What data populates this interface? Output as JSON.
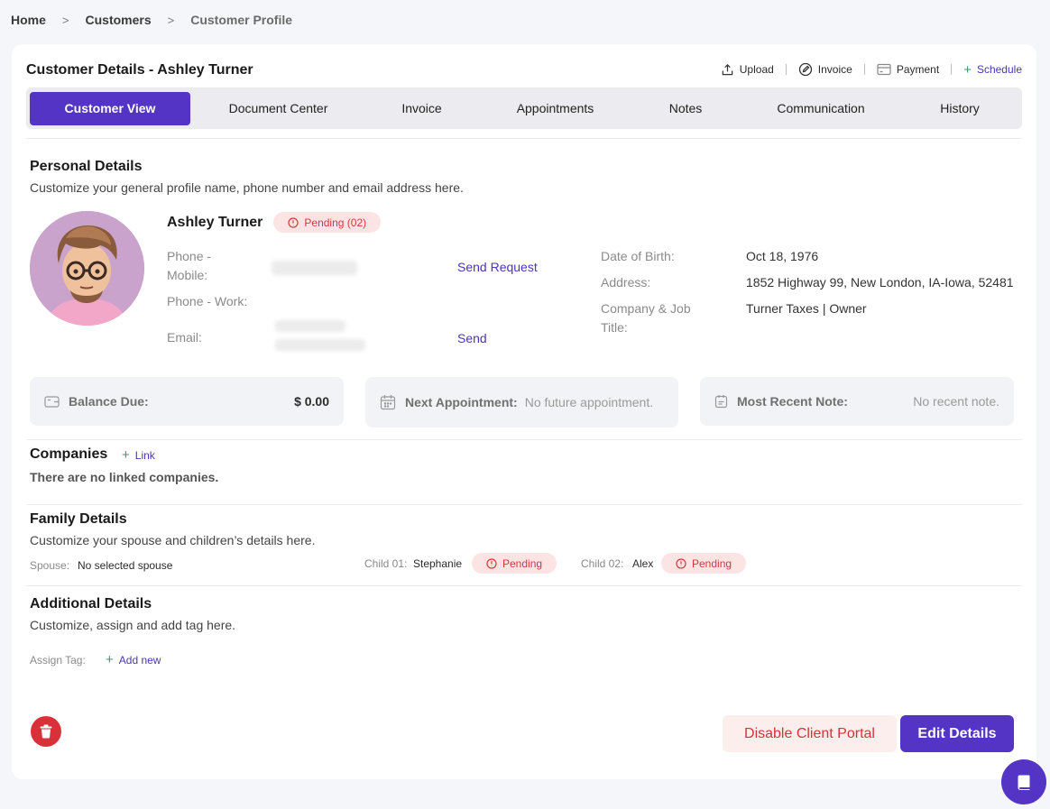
{
  "breadcrumb": {
    "home": "Home",
    "customers": "Customers",
    "current": "Customer Profile",
    "separator": ">"
  },
  "header": {
    "title": "Customer Details - Ashley Turner",
    "actions": {
      "upload": "Upload",
      "invoice": "Invoice",
      "payment": "Payment",
      "schedule": "Schedule"
    }
  },
  "tabs": [
    "Customer View",
    "Document Center",
    "Invoice",
    "Appointments",
    "Notes",
    "Communication",
    "History"
  ],
  "active_tab": "Customer View",
  "personal": {
    "title": "Personal Details",
    "subtitle": "Customize your general profile name, phone number and email address here.",
    "name": "Ashley Turner",
    "pending_badge": "Pending (02)",
    "phone_mobile_label_1": "Phone -",
    "phone_mobile_label_2": "Mobile:",
    "phone_work_label": "Phone - Work:",
    "email_label": "Email:",
    "send_request": "Send Request",
    "send": "Send",
    "dob_label": "Date of Birth:",
    "dob_value": "Oct 18, 1976",
    "address_label": "Address:",
    "address_value": "1852 Highway 99, New London, IA-Iowa, 52481",
    "company_label_1": "Company & Job",
    "company_label_2": "Title:",
    "company_value": "Turner Taxes | Owner"
  },
  "stats": {
    "balance_label": "Balance Due:",
    "balance_value": "$ 0.00",
    "appointment_label": "Next Appointment:",
    "appointment_value": "No future appointment.",
    "note_label": "Most Recent Note:",
    "note_value": "No recent note."
  },
  "companies": {
    "title": "Companies",
    "link": "Link",
    "empty": "There are no linked companies."
  },
  "family": {
    "title": "Family Details",
    "subtitle": "Customize your spouse and children’s details here.",
    "spouse_label": "Spouse:",
    "spouse_value": "No selected spouse",
    "child1_label": "Child 01:",
    "child1_value": "Stephanie",
    "child2_label": "Child 02:",
    "child2_value": "Alex",
    "pending": "Pending"
  },
  "additional": {
    "title": "Additional Details",
    "subtitle": "Customize, assign and add tag here.",
    "tag_label": "Assign Tag:",
    "add_new": "Add new"
  },
  "buttons": {
    "disable": "Disable Client Portal",
    "edit": "Edit Details"
  },
  "colors": {
    "accent": "#5334c4",
    "danger": "#d9313a",
    "pending_bg": "#fde4e4"
  }
}
